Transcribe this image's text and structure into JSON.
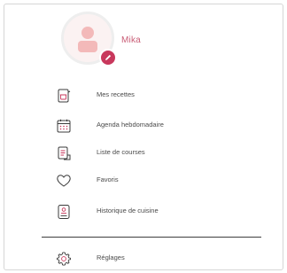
{
  "profile": {
    "name": "Mika",
    "avatar_icon": "user-avatar-icon",
    "edit_icon": "pencil-icon",
    "accent_color": "#c8385c"
  },
  "menu": {
    "items": [
      {
        "label": "Mes recettes",
        "icon": "recipe-pot-icon"
      },
      {
        "label": "Agenda hebdomadaire",
        "icon": "calendar-icon"
      },
      {
        "label": "Liste de courses",
        "icon": "shopping-list-icon"
      },
      {
        "label": "Favoris",
        "icon": "heart-icon"
      },
      {
        "label": "Historique de cuisine",
        "icon": "history-book-icon"
      }
    ],
    "settings": {
      "label": "Réglages",
      "icon": "gear-icon"
    }
  }
}
